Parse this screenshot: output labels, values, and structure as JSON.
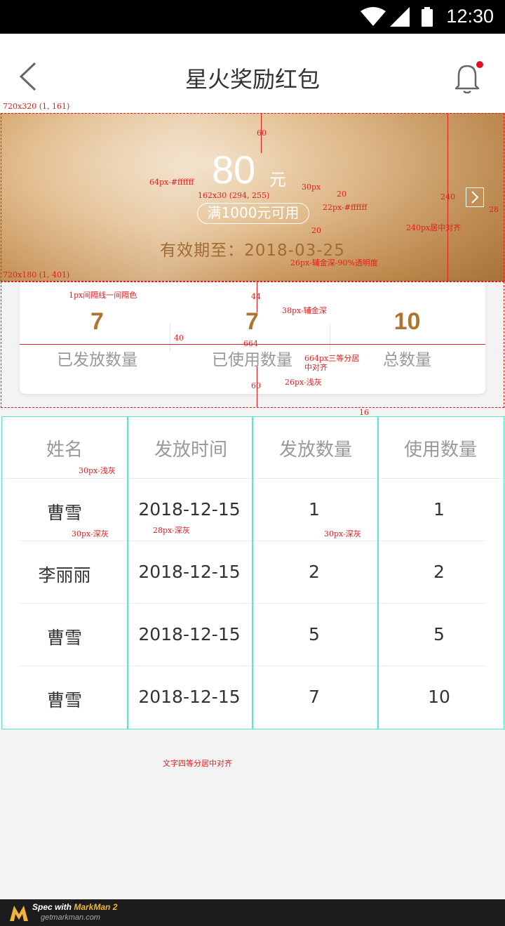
{
  "status_bar": {
    "time": "12:30"
  },
  "nav": {
    "title": "星火奖励红包"
  },
  "banner": {
    "amount": "80",
    "unit": "元",
    "condition": "满1000元可用",
    "expire_label": "有效期至：2018-03-25"
  },
  "stats": [
    {
      "value": "7",
      "label": "已发放数量"
    },
    {
      "value": "7",
      "label": "已使用数量"
    },
    {
      "value": "10",
      "label": "总数量"
    }
  ],
  "table": {
    "headers": [
      "姓名",
      "发放时间",
      "发放数量",
      "使用数量"
    ],
    "rows": [
      {
        "name": "曹雪",
        "date": "2018-12-15",
        "issued": "1",
        "used": "1"
      },
      {
        "name": "李丽丽",
        "date": "2018-12-15",
        "issued": "2",
        "used": "2"
      },
      {
        "name": "曹雪",
        "date": "2018-12-15",
        "issued": "5",
        "used": "5"
      },
      {
        "name": "曹雪",
        "date": "2018-12-15",
        "issued": "7",
        "used": "10"
      }
    ]
  },
  "annotations": {
    "banner_size": "720x320 (1, 161)",
    "card_size": "720x180 (1, 401)",
    "gap_60": "60",
    "amount_style": "64px-#ffffff",
    "unit_style": "30px",
    "cond_size": "162x30 (294, 255)",
    "gap_20a": "20",
    "cond_style": "22px-#ffffff",
    "gap_20b": "20",
    "height_240": "240",
    "gap_28": "28",
    "center_240": "240px居中对齐",
    "expire_style": "26px-辅金深-90%透明度",
    "divider_note": "1px间隔线一间隔色",
    "gap_44": "44",
    "num_style": "38px-辅金深",
    "gap_40": "40",
    "width_664": "664",
    "split_note_1": "664px三等分居",
    "split_note_2": "中对齐",
    "label_style": "26px-浅灰",
    "gap_60b": "60",
    "gap_16": "16",
    "head_style": "30px-浅灰",
    "name_style": "30px-深灰",
    "date_style": "28px-深灰",
    "qty_style": "30px-深灰",
    "table_note": "文字四等分居中对齐"
  },
  "footer": {
    "brand_prefix": "Spec with ",
    "brand_name": "MarkMan 2",
    "url": "getmarkman.com"
  },
  "colors": {
    "accent_gold": "#b07432",
    "annotation_red": "#e02020",
    "annotation_cyan": "#55e8c8",
    "notification_dot": "#e0141e"
  }
}
